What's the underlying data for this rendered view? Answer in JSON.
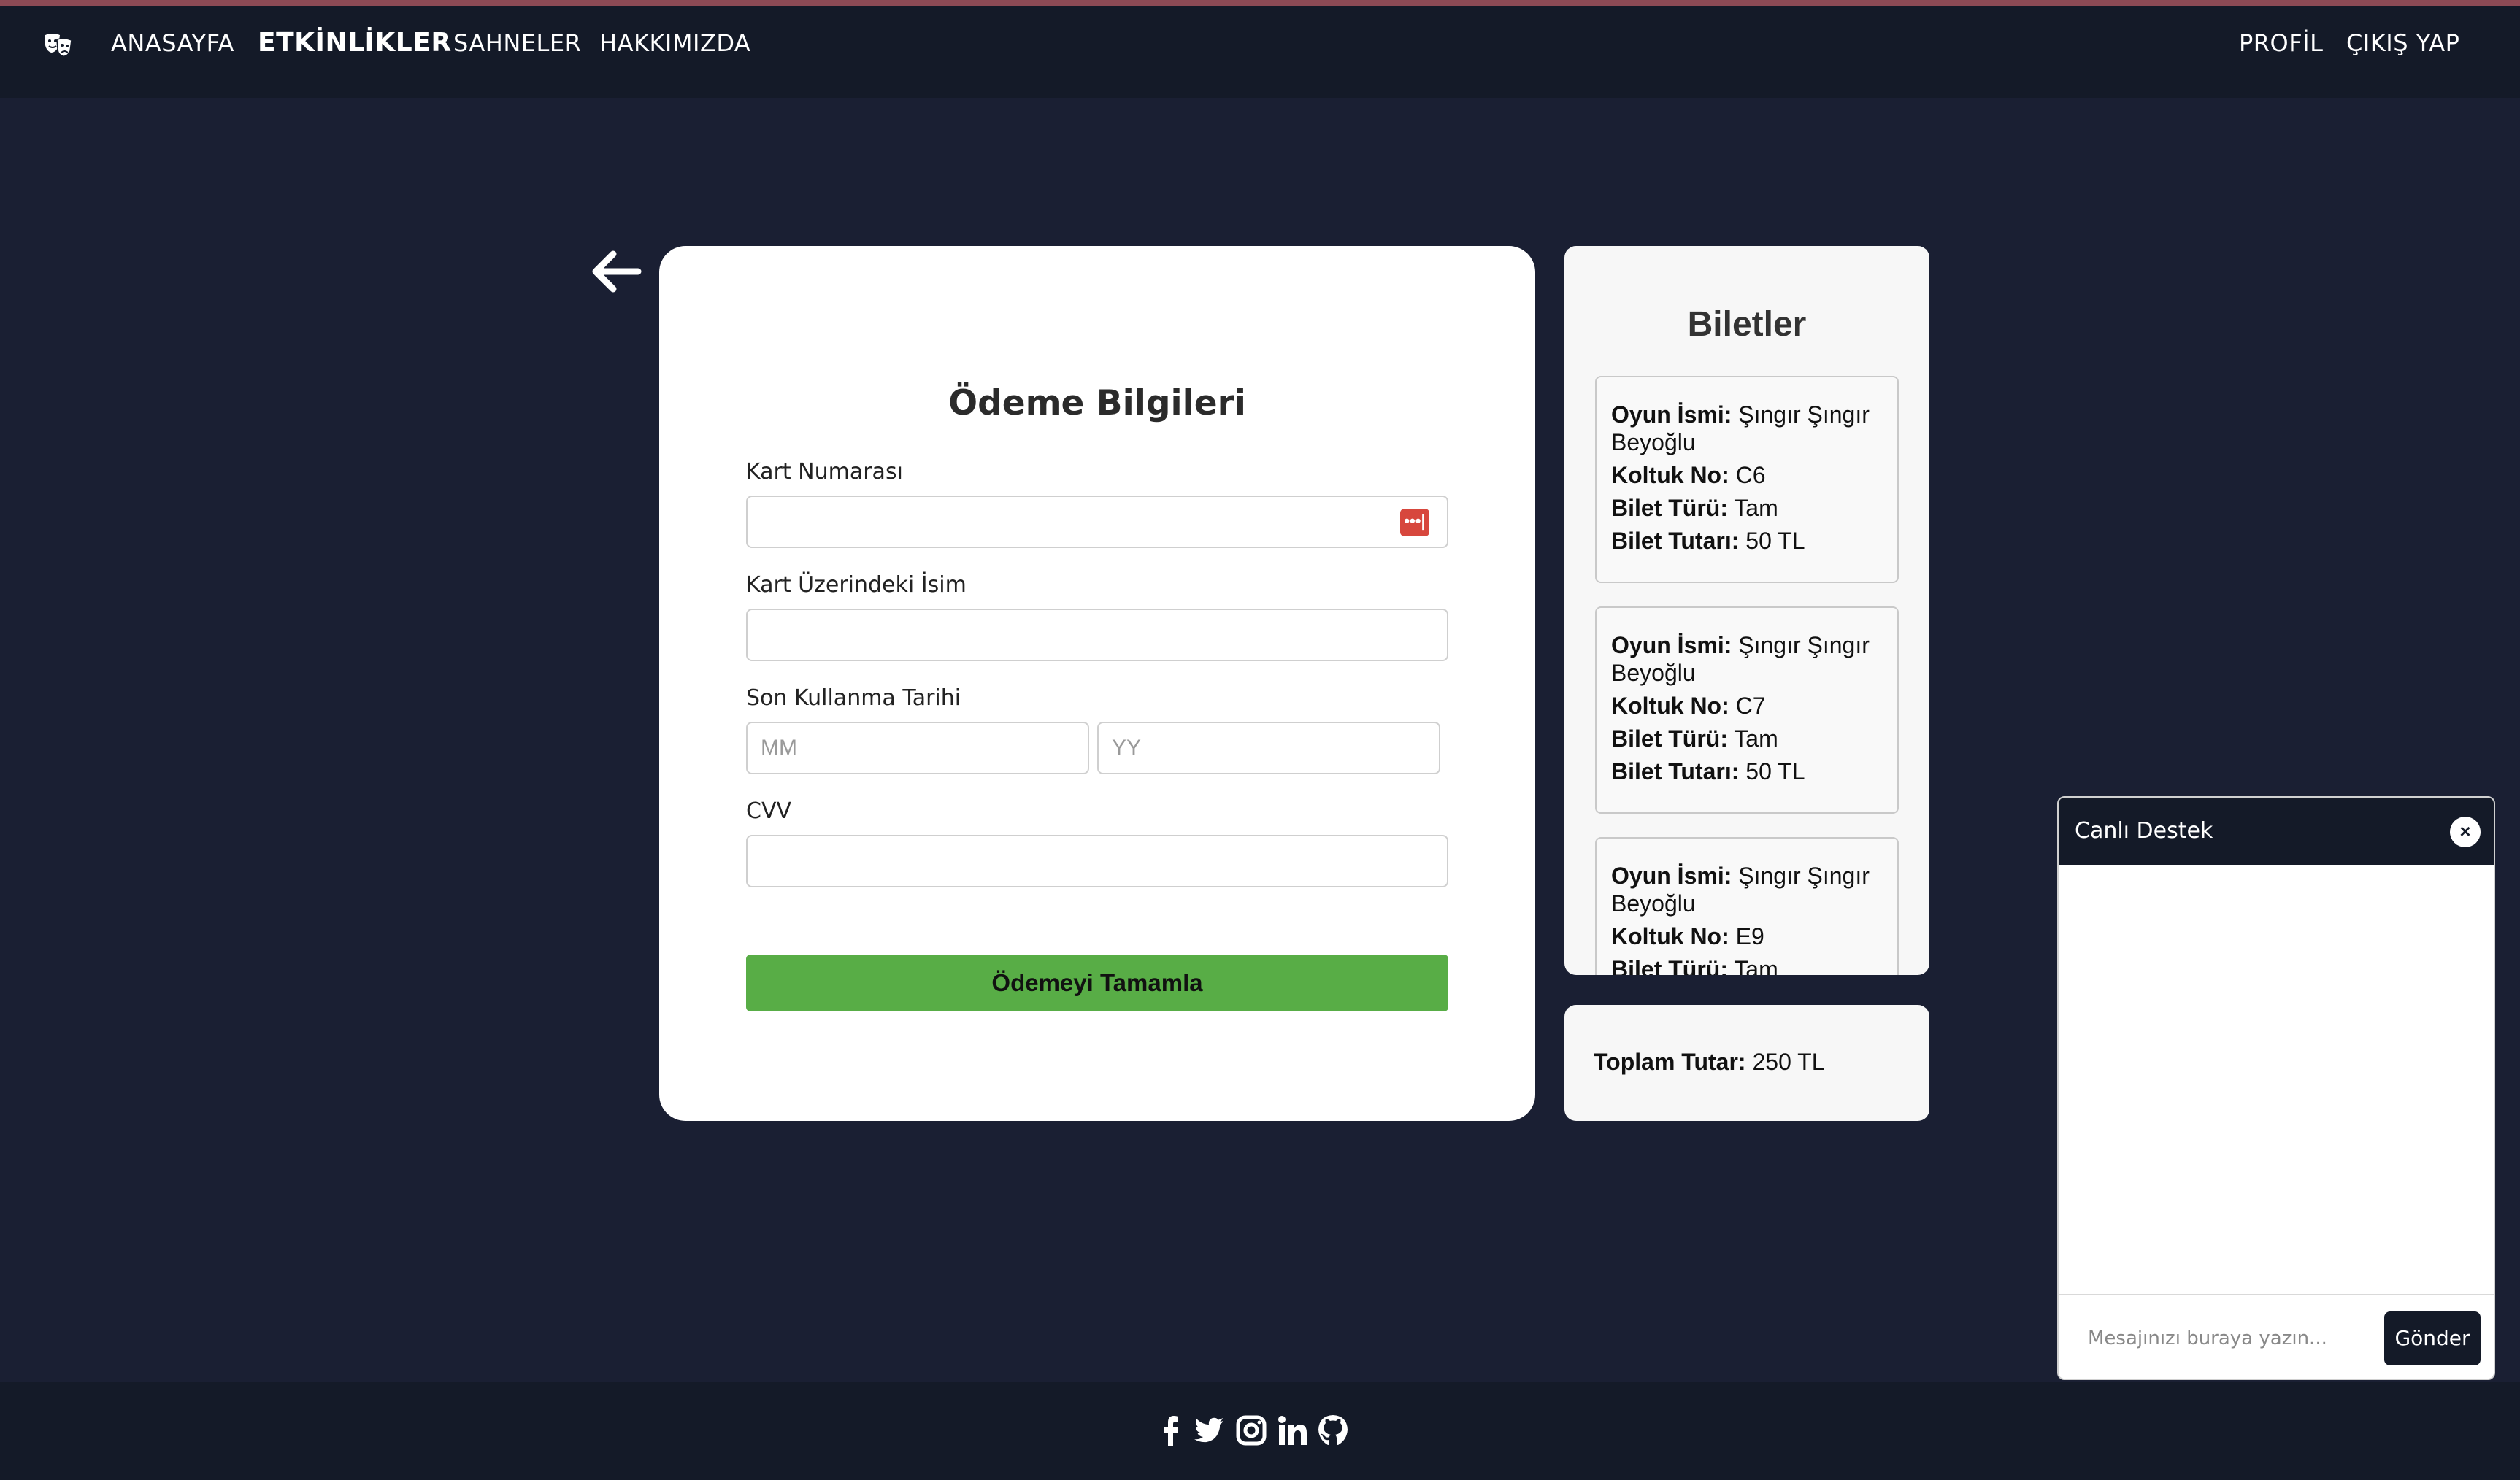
{
  "nav": {
    "links": [
      "ANASAYFA",
      "ETKİNLİKLER",
      "SAHNELER",
      "HAKKIMIZDA"
    ],
    "active": "ETKİNLİKLER",
    "right_links": [
      "PROFİL",
      "ÇIKIŞ YAP"
    ],
    "logo_icon": "theater-masks-icon"
  },
  "payment": {
    "title": "Ödeme Bilgileri",
    "card_number_label": "Kart Numarası",
    "card_number_value": "",
    "card_name_label": "Kart Üzerindeki İsim",
    "card_name_value": "",
    "expiry_label": "Son Kullanma Tarihi",
    "expiry_month_placeholder": "MM",
    "expiry_year_placeholder": "YY",
    "cvv_label": "CVV",
    "cvv_value": "",
    "submit_label": "Ödemeyi Tamamla",
    "password_manager_icon": "•••|"
  },
  "tickets": {
    "title": "Biletler",
    "field_labels": {
      "play": "Oyun İsmi:",
      "seat": "Koltuk No:",
      "type": "Bilet Türü:",
      "price": "Bilet Tutarı:"
    },
    "items": [
      {
        "play": "Şıngır Şıngır Beyoğlu",
        "seat": "C6",
        "type": "Tam",
        "price": "50 TL"
      },
      {
        "play": "Şıngır Şıngır Beyoğlu",
        "seat": "C7",
        "type": "Tam",
        "price": "50 TL"
      },
      {
        "play": "Şıngır Şıngır Beyoğlu",
        "seat": "E9",
        "type": "Tam",
        "price": ""
      }
    ]
  },
  "total": {
    "label": "Toplam Tutar:",
    "value": "250 TL"
  },
  "chat": {
    "title": "Canlı Destek",
    "close_icon": "×",
    "input_placeholder": "Mesajınızı buraya yazın...",
    "send_label": "Gönder"
  },
  "footer": {
    "social_icons": [
      "facebook-icon",
      "twitter-icon",
      "instagram-icon",
      "linkedin-icon",
      "github-icon"
    ]
  },
  "colors": {
    "page_background": "#1a1f33",
    "navbar": "#141a28",
    "pay_button": "#58ad46",
    "accent_top_line": "#8c4a55"
  }
}
